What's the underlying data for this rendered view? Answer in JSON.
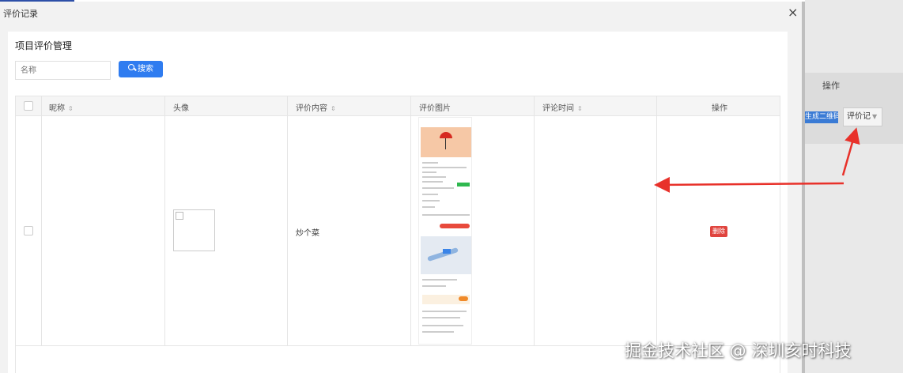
{
  "modal": {
    "title": "评价记录",
    "close_glyph": "×"
  },
  "panel": {
    "title": "项目评价管理"
  },
  "search": {
    "placeholder": "名称",
    "button_label": "搜索"
  },
  "table": {
    "columns": [
      {
        "label": "昵称",
        "sortable": true
      },
      {
        "label": "头像",
        "sortable": false
      },
      {
        "label": "评价内容",
        "sortable": true
      },
      {
        "label": "评价图片",
        "sortable": false
      },
      {
        "label": "评论时间",
        "sortable": true
      },
      {
        "label": "操作",
        "sortable": false
      }
    ],
    "sort_glyph": "⇕",
    "rows": [
      {
        "nickname": "",
        "content": "炒个菜",
        "time": "",
        "action_label": "删除"
      }
    ]
  },
  "background": {
    "op_label": "操作",
    "qr_button": "生成二维码",
    "review_button": "评价记",
    "caret": "▼"
  },
  "watermark": "掘金技术社区 @ 深圳亥时科技",
  "colors": {
    "primary": "#2f7cf0",
    "danger": "#e0443e",
    "annotation": "#e8312a"
  }
}
